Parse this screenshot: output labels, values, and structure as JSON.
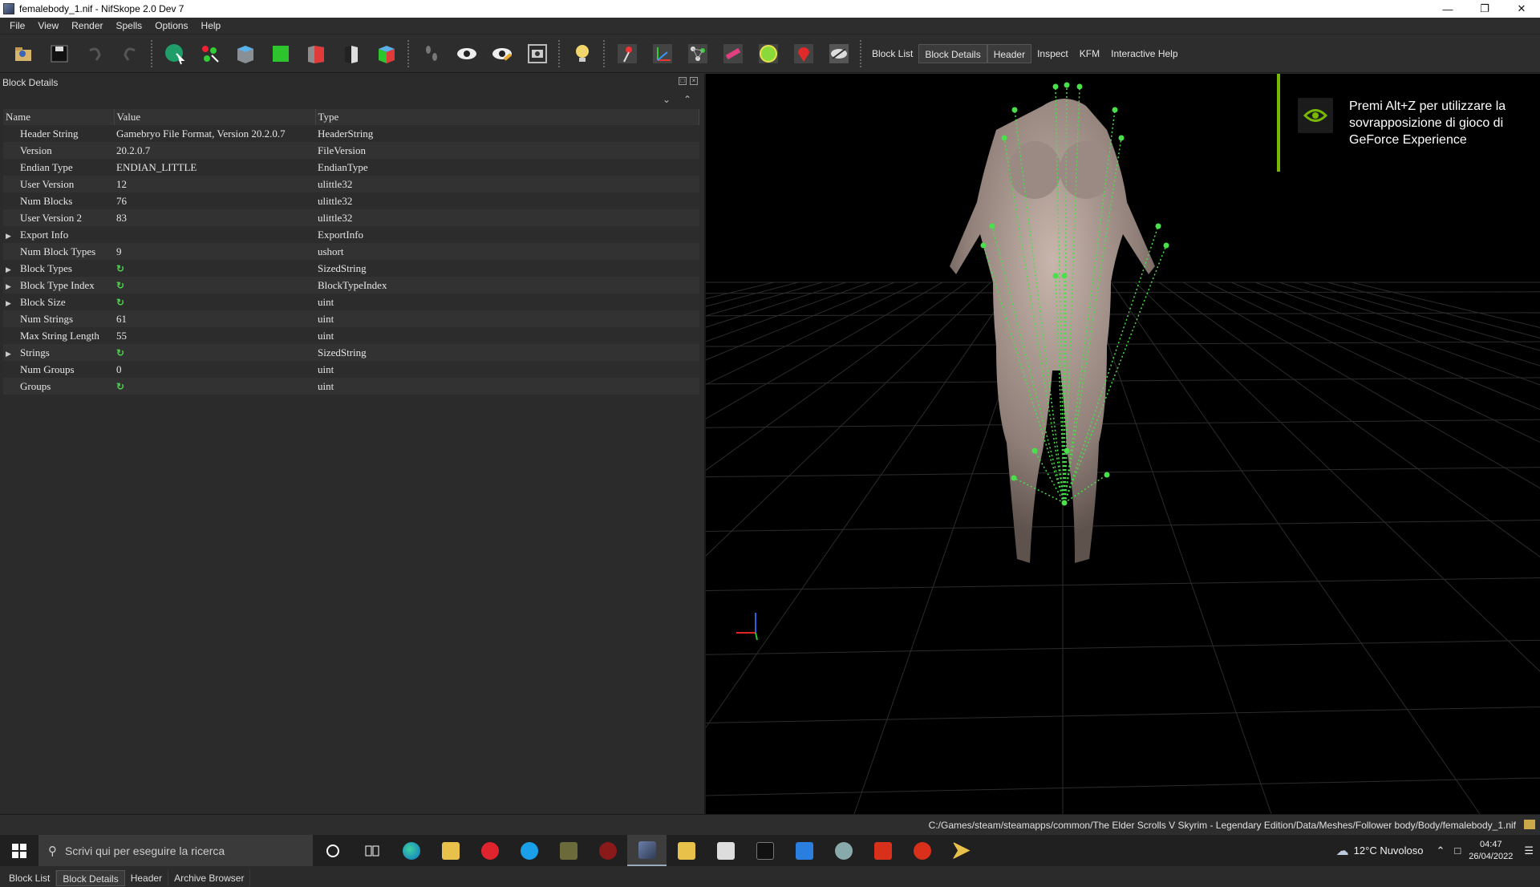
{
  "window": {
    "title": "femalebody_1.nif - NifSkope 2.0 Dev 7"
  },
  "menu": [
    "File",
    "View",
    "Render",
    "Spells",
    "Options",
    "Help"
  ],
  "toolbar_tabs": [
    {
      "label": "Block List",
      "active": false
    },
    {
      "label": "Block Details",
      "active": true
    },
    {
      "label": "Header",
      "active": true
    },
    {
      "label": "Inspect",
      "active": false
    },
    {
      "label": "KFM",
      "active": false
    },
    {
      "label": "Interactive Help",
      "active": false
    }
  ],
  "panel": {
    "title": "Block Details",
    "columns": [
      "Name",
      "Value",
      "Type"
    ],
    "rows": [
      {
        "name": "Header String",
        "value": "Gamebryo File Format, Version 20.2.0.7",
        "type": "HeaderString",
        "expandable": false,
        "refresh": false
      },
      {
        "name": "Version",
        "value": "20.2.0.7",
        "type": "FileVersion",
        "expandable": false,
        "refresh": false
      },
      {
        "name": "Endian Type",
        "value": "ENDIAN_LITTLE",
        "type": "EndianType",
        "expandable": false,
        "refresh": false
      },
      {
        "name": "User Version",
        "value": "12",
        "type": "ulittle32",
        "expandable": false,
        "refresh": false
      },
      {
        "name": "Num Blocks",
        "value": "76",
        "type": "ulittle32",
        "expandable": false,
        "refresh": false
      },
      {
        "name": "User Version 2",
        "value": "83",
        "type": "ulittle32",
        "expandable": false,
        "refresh": false
      },
      {
        "name": "Export Info",
        "value": "",
        "type": "ExportInfo",
        "expandable": true,
        "refresh": false
      },
      {
        "name": "Num Block Types",
        "value": "9",
        "type": "ushort",
        "expandable": false,
        "refresh": false
      },
      {
        "name": "Block Types",
        "value": "",
        "type": "SizedString",
        "expandable": true,
        "refresh": true
      },
      {
        "name": "Block Type Index",
        "value": "",
        "type": "BlockTypeIndex",
        "expandable": true,
        "refresh": true
      },
      {
        "name": "Block Size",
        "value": "",
        "type": "uint",
        "expandable": true,
        "refresh": true
      },
      {
        "name": "Num Strings",
        "value": "61",
        "type": "uint",
        "expandable": false,
        "refresh": false
      },
      {
        "name": "Max String Length",
        "value": "55",
        "type": "uint",
        "expandable": false,
        "refresh": false
      },
      {
        "name": "Strings",
        "value": "",
        "type": "SizedString",
        "expandable": true,
        "refresh": true
      },
      {
        "name": "Num Groups",
        "value": "0",
        "type": "uint",
        "expandable": false,
        "refresh": false
      },
      {
        "name": "Groups",
        "value": "",
        "type": "uint",
        "expandable": false,
        "refresh": true
      }
    ]
  },
  "bottom_tabs": [
    {
      "label": "Block List",
      "active": false
    },
    {
      "label": "Block Details",
      "active": true
    },
    {
      "label": "Header",
      "active": false
    },
    {
      "label": "Archive Browser",
      "active": false
    }
  ],
  "overlay": {
    "text": "Premi Alt+Z per utilizzare la sovrapposizione di gioco di GeForce Experience",
    "accent": "#76b900"
  },
  "statusbar": {
    "path": "C:/Games/steam/steamapps/common/The Elder Scrolls V Skyrim - Legendary Edition/Data/Meshes/Follower body/Body/femalebody_1.nif"
  },
  "taskbar": {
    "search_placeholder": "Scrivi qui per eseguire la ricerca",
    "weather": "12°C  Nuvoloso",
    "time": "04:47",
    "date": "26/04/2022"
  },
  "colors": {
    "skeleton": "#49e04a",
    "panel_bg": "#2b2b2b",
    "viewport_bg": "#000000"
  }
}
